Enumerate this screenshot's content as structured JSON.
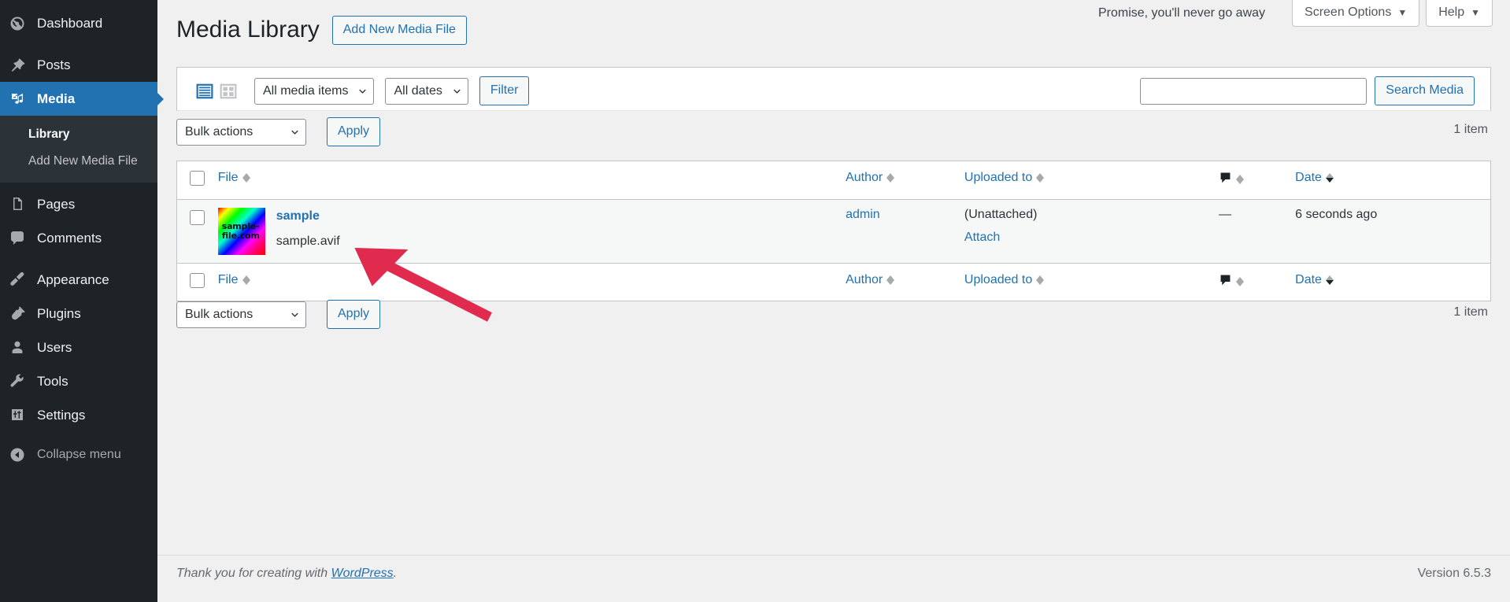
{
  "sidebar": {
    "items": [
      {
        "label": "Dashboard",
        "icon": "dashboard-icon",
        "current": false
      },
      {
        "label": "Posts",
        "icon": "pin-icon",
        "current": false
      },
      {
        "label": "Media",
        "icon": "media-icon",
        "current": true
      },
      {
        "label": "Pages",
        "icon": "pages-icon",
        "current": false
      },
      {
        "label": "Comments",
        "icon": "comments-icon",
        "current": false
      },
      {
        "label": "Appearance",
        "icon": "appearance-icon",
        "current": false
      },
      {
        "label": "Plugins",
        "icon": "plugins-icon",
        "current": false
      },
      {
        "label": "Users",
        "icon": "users-icon",
        "current": false
      },
      {
        "label": "Tools",
        "icon": "tools-icon",
        "current": false
      },
      {
        "label": "Settings",
        "icon": "settings-icon",
        "current": false
      }
    ],
    "submenu": [
      {
        "label": "Library",
        "current": true
      },
      {
        "label": "Add New Media File",
        "current": false
      }
    ],
    "collapse": {
      "label": "Collapse menu",
      "icon": "collapse-arrow-icon"
    }
  },
  "screen_meta": {
    "promise_text": "Promise, you'll never go away",
    "screen_options_label": "Screen Options",
    "help_label": "Help",
    "caret": "▼"
  },
  "header": {
    "title": "Media Library",
    "add_new_label": "Add New Media File"
  },
  "toolbar": {
    "list_view_icon": "list-view-icon",
    "grid_view_icon": "grid-view-icon",
    "media_filter_value": "All media items",
    "dates_filter_value": "All dates",
    "filter_label": "Filter",
    "search_value": "",
    "search_placeholder": "",
    "search_button_label": "Search Media"
  },
  "bulk": {
    "select_value": "Bulk actions",
    "apply_label": "Apply",
    "item_count": "1 item"
  },
  "table": {
    "columns": [
      {
        "key": "cb",
        "label": ""
      },
      {
        "key": "title",
        "label": "File",
        "sortable": true,
        "sorted": "none"
      },
      {
        "key": "author",
        "label": "Author",
        "sortable": true,
        "sorted": "none"
      },
      {
        "key": "parent",
        "label": "Uploaded to",
        "sortable": true,
        "sorted": "none"
      },
      {
        "key": "comments",
        "label": "comment-bubble-icon",
        "sortable": true,
        "sorted": "none"
      },
      {
        "key": "date",
        "label": "Date",
        "sortable": true,
        "sorted": "desc"
      }
    ],
    "rows": [
      {
        "thumb_text_line1": "sample-",
        "thumb_text_line2": "file.com",
        "title": "sample",
        "filename": "sample.avif",
        "author": "admin",
        "uploaded_to": "(Unattached)",
        "attach_label": "Attach",
        "comments": "—",
        "date": "6 seconds ago"
      }
    ]
  },
  "footer": {
    "thanks_prefix": "Thank you for creating with ",
    "wordpress_link": "WordPress",
    "thanks_suffix": ".",
    "version": "Version 6.5.3"
  },
  "colors": {
    "admin_bg": "#1d2327",
    "submenu_bg": "#2c3338",
    "accent_blue": "#2271b1",
    "content_bg": "#f0f0f1",
    "annotation_red": "#e02a4e"
  }
}
